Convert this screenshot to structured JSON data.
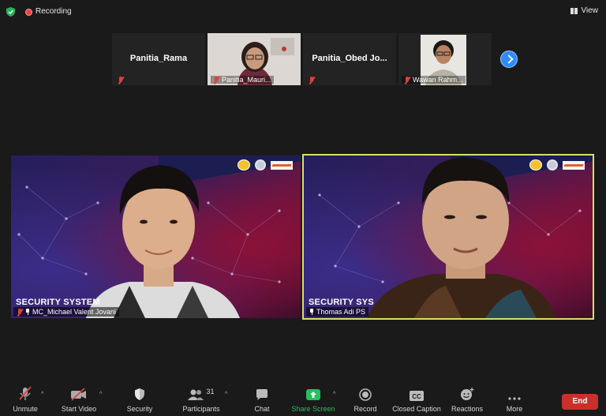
{
  "topbar": {
    "recording_label": "Recording",
    "view_label": "View"
  },
  "gallery_strip": [
    {
      "type": "name",
      "display": "Panitia_Rama",
      "caption": ""
    },
    {
      "type": "video",
      "display": "",
      "caption": "Panitia_Mauri..."
    },
    {
      "type": "name",
      "display": "Panitia_Obed  Jo...",
      "caption": ""
    },
    {
      "type": "video",
      "display": "",
      "caption": "Wawan Rahm..."
    }
  ],
  "main_videos": [
    {
      "overlay_text": "SECURITY SYSTEM",
      "caption": "MC_Michael Valent Jovani",
      "active_speaker": false
    },
    {
      "overlay_text": "SECURITY SYS",
      "caption": "Thomas Adi PS",
      "active_speaker": true
    }
  ],
  "toolbar": {
    "unmute": "Unmute",
    "start_video": "Start Video",
    "security": "Security",
    "participants": "Participants",
    "participants_count": "31",
    "chat": "Chat",
    "share_screen": "Share Screen",
    "record": "Record",
    "closed_caption": "Closed Caption",
    "reactions": "Reactions",
    "more": "More",
    "end": "End"
  },
  "colors": {
    "accent_blue": "#2d8cff",
    "share_green": "#21c15b",
    "end_red": "#c9302c",
    "active_border": "#d5e06b",
    "muted_red": "#e04040"
  }
}
